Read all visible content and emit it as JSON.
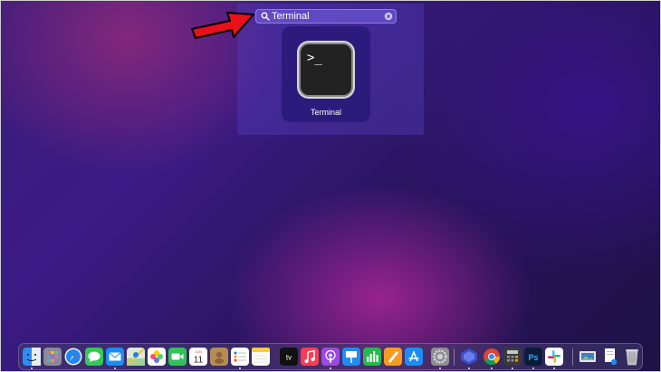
{
  "search": {
    "value": "Terminal",
    "icon": "magnifying-glass-icon"
  },
  "result": {
    "label": "Terminal",
    "icon_text": ">_"
  },
  "annotation": {
    "arrow_color": "#e8111a"
  },
  "dock": {
    "apps": [
      "finder-icon",
      "launchpad-icon",
      "safari-icon",
      "messages-icon",
      "mail-icon",
      "maps-icon",
      "photos-icon",
      "facetime-icon",
      "calendar-icon",
      "contacts-icon",
      "reminders-icon",
      "notes-icon",
      "apple-tv-icon",
      "music-icon",
      "podcasts-icon",
      "keynote-icon",
      "numbers-icon",
      "pages-icon",
      "app-store-icon",
      "system-preferences-icon",
      "creative-cloud-icon",
      "chrome-icon",
      "calculator-icon",
      "photoshop-icon",
      "slack-icon",
      "preview-icon",
      "document-icon",
      "trash-icon"
    ],
    "calendar": {
      "month": "JUN",
      "day": "11"
    },
    "tv_label": "tv",
    "photoshop_label": "Ps"
  }
}
